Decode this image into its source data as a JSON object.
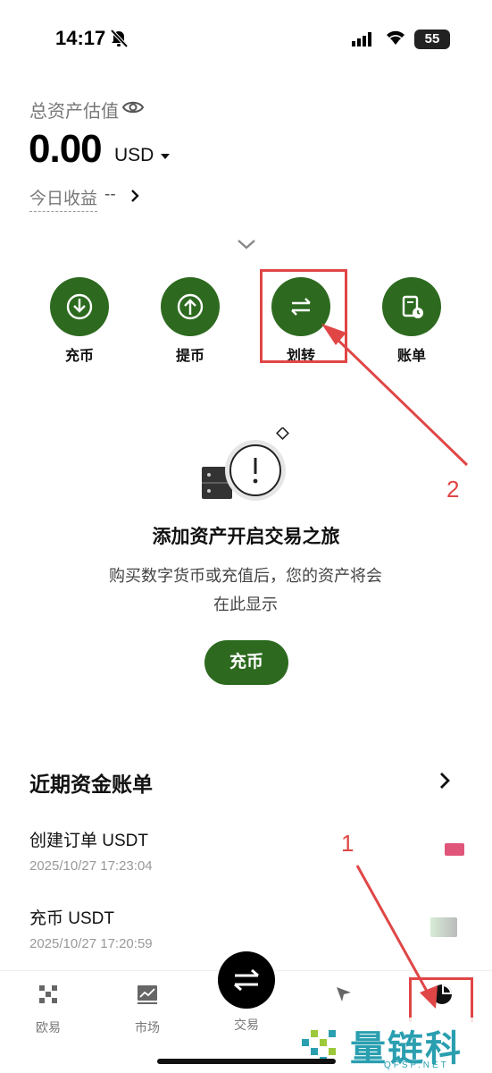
{
  "status_bar": {
    "time": "14:17",
    "battery": "55"
  },
  "assets": {
    "label": "总资产估值",
    "value": "0.00",
    "currency": "USD",
    "today_label": "今日收益",
    "today_value": "--"
  },
  "actions": [
    {
      "label": "充币",
      "icon": "download-icon"
    },
    {
      "label": "提币",
      "icon": "upload-icon"
    },
    {
      "label": "划转",
      "icon": "transfer-icon"
    },
    {
      "label": "账单",
      "icon": "bill-icon"
    }
  ],
  "empty_state": {
    "title": "添加资产开启交易之旅",
    "description": "购买数字货币或充值后，您的资产将会在此显示",
    "button": "充币"
  },
  "recent": {
    "title": "近期资金账单",
    "items": [
      {
        "title": "创建订单 USDT",
        "time": "2025/10/27 17:23:04"
      },
      {
        "title": "充币 USDT",
        "time": "2025/10/27 17:20:59"
      }
    ]
  },
  "nav": [
    {
      "label": "欧易",
      "icon": "okx-logo-icon"
    },
    {
      "label": "市场",
      "icon": "market-chart-icon"
    },
    {
      "label": "交易",
      "icon": "trade-swap-icon"
    },
    {
      "label": "",
      "icon": "discover-compass-icon"
    },
    {
      "label": "",
      "icon": "assets-pie-icon"
    }
  ],
  "annotations": {
    "first": "1",
    "second": "2"
  },
  "watermark": {
    "text": "量链科技",
    "sub": "QFSP.NET"
  },
  "colors": {
    "brand_green": "#2d6a1f",
    "annotation_red": "#e04646",
    "watermark_blue": "#2a9fb0"
  }
}
